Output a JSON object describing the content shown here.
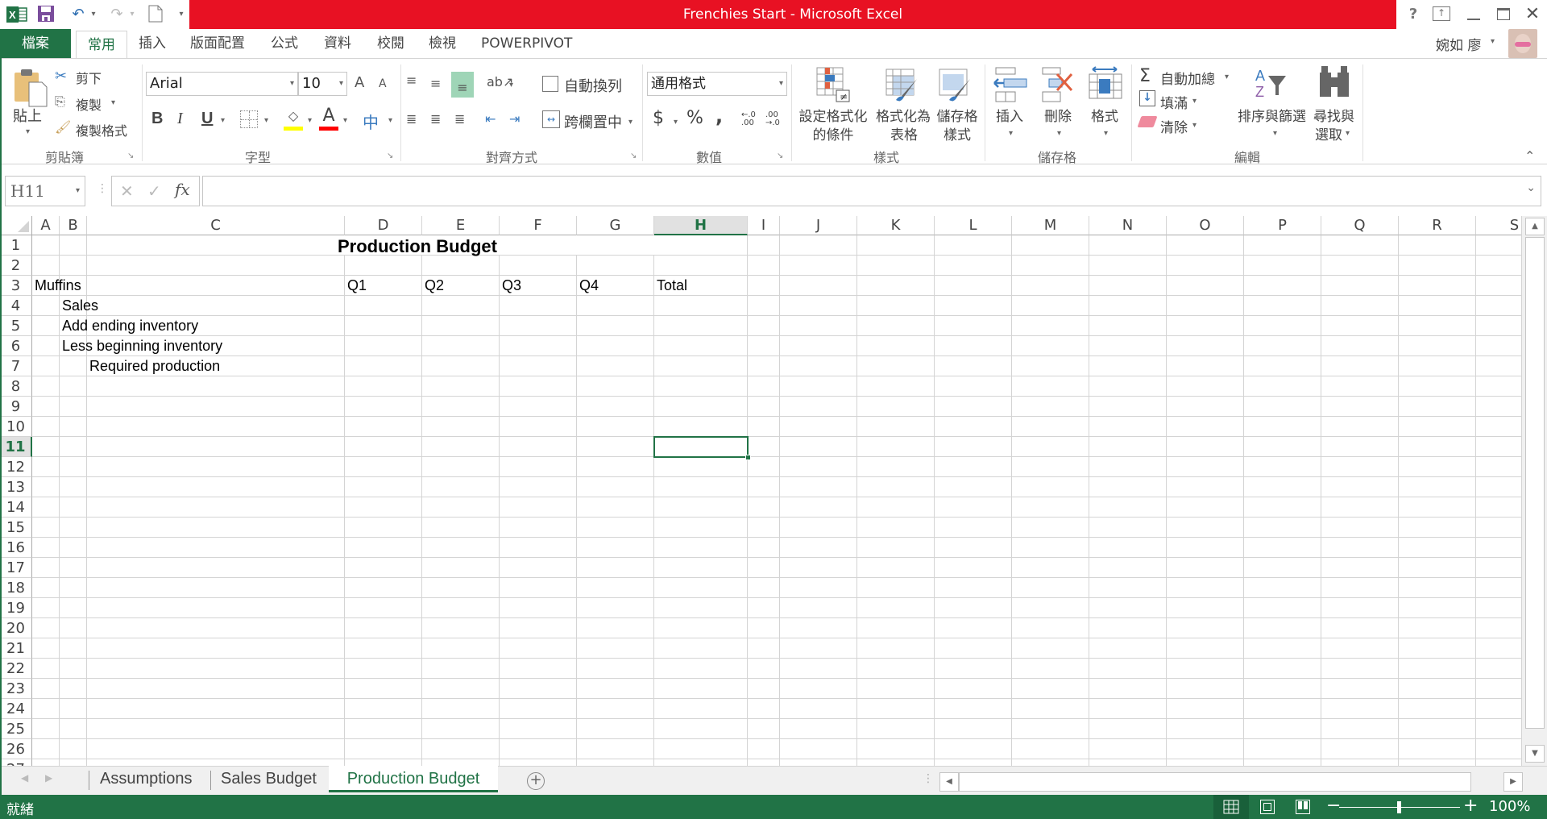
{
  "window": {
    "title": "Frenchies Start -  Microsoft Excel",
    "help_label": "?",
    "user_name": "婉如 廖"
  },
  "ribbon_tabs": [
    {
      "label": "檔案"
    },
    {
      "label": "常用"
    },
    {
      "label": "插入"
    },
    {
      "label": "版面配置"
    },
    {
      "label": "公式"
    },
    {
      "label": "資料"
    },
    {
      "label": "校閱"
    },
    {
      "label": "檢視"
    },
    {
      "label": "POWERPIVOT"
    }
  ],
  "clipboard": {
    "group_label": "剪貼簿",
    "paste": "貼上",
    "cut": "剪下",
    "copy": "複製",
    "format_painter": "複製格式"
  },
  "font": {
    "group_label": "字型",
    "font_name": "Arial",
    "font_size": "10",
    "bold": "B",
    "italic": "I",
    "underline": "U",
    "grow": "A",
    "shrink": "A",
    "phonetic": "中",
    "font_color": "A",
    "fill_color_hex": "#ffff00",
    "font_color_hex": "#ff0000"
  },
  "alignment": {
    "group_label": "對齊方式",
    "wrap_text": "自動換列",
    "merge_center": "跨欄置中"
  },
  "number": {
    "group_label": "數值",
    "format": "通用格式",
    "currency": "$",
    "percent": "%",
    "comma": ",",
    "inc_decimal": "←.0 .00",
    "dec_decimal": ".00 →.0"
  },
  "styles": {
    "group_label": "樣式",
    "conditional": [
      "設定格式化",
      "的條件"
    ],
    "format_table": [
      "格式化為",
      "表格"
    ],
    "cell_styles": [
      "儲存格",
      "樣式"
    ]
  },
  "cells": {
    "group_label": "儲存格",
    "insert": "插入",
    "delete": "刪除",
    "format": "格式"
  },
  "editing": {
    "group_label": "編輯",
    "autosum": "自動加總",
    "fill": "填滿",
    "clear": "清除",
    "sort_filter": "排序與篩選",
    "find_select": [
      "尋找與",
      "選取"
    ]
  },
  "formula_bar": {
    "name_box": "H11",
    "fx": "fx",
    "formula": ""
  },
  "columns": [
    "A",
    "B",
    "C",
    "D",
    "E",
    "F",
    "G",
    "H",
    "I",
    "J",
    "K",
    "L",
    "M",
    "N",
    "O",
    "P",
    "Q",
    "R",
    "S"
  ],
  "selected_column": "H",
  "rows": [
    "1",
    "2",
    "3",
    "4",
    "5",
    "6",
    "7",
    "8",
    "9",
    "10",
    "11",
    "12",
    "13",
    "14",
    "15",
    "16",
    "17",
    "18",
    "19",
    "20",
    "21",
    "22",
    "23",
    "24",
    "25",
    "26"
  ],
  "selected_row": "11",
  "sheet": {
    "title": "Production Budget",
    "A3": "Muffins",
    "B4": "Sales",
    "B5": "Add ending inventory",
    "B6": "Less beginning inventory",
    "C7": "Required production",
    "D3": "Q1",
    "E3": "Q2",
    "F3": "Q3",
    "G3": "Q4",
    "H3": "Total"
  },
  "sheet_tabs": [
    {
      "label": "Assumptions",
      "active": false
    },
    {
      "label": "Sales Budget",
      "active": false
    },
    {
      "label": "Production Budget",
      "active": true
    }
  ],
  "status": {
    "ready": "就緒",
    "zoom": "100%",
    "zoom_level_percent": 100
  },
  "colors": {
    "excel_green": "#217346",
    "title_red": "#e81123",
    "grid_line": "#d4d4d4"
  }
}
